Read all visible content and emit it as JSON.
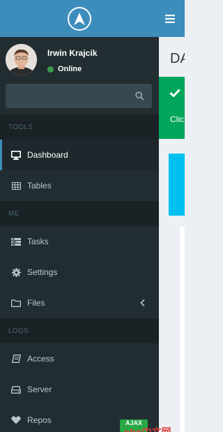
{
  "user": {
    "name": "Irwin Krajcik",
    "status": "Online"
  },
  "search": {
    "placeholder": ""
  },
  "sections": {
    "tools": "TOOLS",
    "me": "ME",
    "logs": "LOGS"
  },
  "menu": {
    "dashboard": "Dashboard",
    "tables": "Tables",
    "tasks": "Tasks",
    "settings": "Settings",
    "files": "Files",
    "access": "Access",
    "server": "Server",
    "repos": "Repos"
  },
  "content": {
    "page_title": "DA",
    "callout_text": "Clic"
  },
  "watermark": {
    "badge": "AJAX",
    "text": "php中文网"
  },
  "colors": {
    "brand": "#3c8dbc",
    "sidebar": "#222d32",
    "online": "#3c9a4e",
    "success": "#00a65a",
    "info": "#00c0ef"
  },
  "icons": {
    "logo": "navigation-arrow-icon",
    "search": "search-icon",
    "dashboard": "desktop-icon",
    "tables": "table-icon",
    "tasks": "tasks-icon",
    "settings": "gear-icon",
    "files": "folder-icon",
    "access": "book-icon",
    "server": "hdd-icon",
    "repos": "heart-icon",
    "toggle": "hamburger-icon"
  }
}
